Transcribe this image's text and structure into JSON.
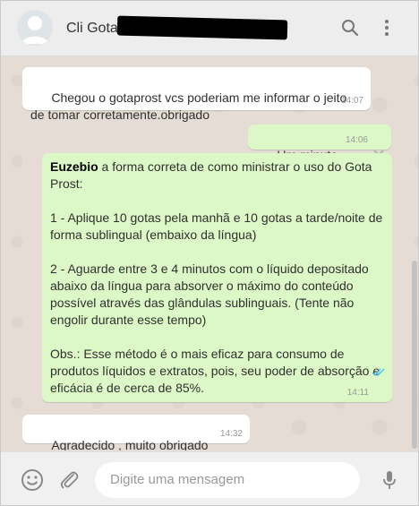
{
  "header": {
    "contact_name": "Cli Gota",
    "avatar_icon": "default-avatar-icon",
    "search_icon": "search-icon",
    "menu_icon": "menu-dots-icon"
  },
  "messages": [
    {
      "direction": "incoming",
      "text": "Chegou o gotaprost vcs poderiam me informar o jeito de tomar corretamente.obrigado",
      "time": "14:07"
    },
    {
      "direction": "outgoing",
      "text": "Um minuto",
      "time": "14:06"
    },
    {
      "direction": "outgoing",
      "sender": "Euzebio",
      "text": " a forma correta de como ministrar o uso do Gota Prost:\n\n1 - Aplique 10 gotas pela manhã e 10 gotas a tarde/noite de forma sublingual (embaixo da língua)\n\n2 - Aguarde entre 3 e 4 minutos com o líquido depositado abaixo da língua para absorver o máximo do conteúdo possível através das glândulas sublinguais. (Tente não engolir durante esse tempo)\n\nObs.: Esse método é o mais eficaz para consumo de produtos líquidos e extratos, pois, seu poder de absorção e eficácia é de cerca de 85%.",
      "time": "14:11",
      "status": "read"
    },
    {
      "direction": "incoming",
      "text": "Agradecido , muito obrigado",
      "time": "14:32"
    }
  ],
  "composer": {
    "placeholder": "Digite uma mensagem",
    "emoji_icon": "emoji-icon",
    "attach_icon": "attach-clip-icon",
    "mic_icon": "microphone-icon"
  },
  "colors": {
    "incoming_bubble": "#ffffff",
    "outgoing_bubble": "#dcf8c6",
    "read_ticks": "#4fc3f7",
    "chat_background": "#e5ddd5"
  }
}
